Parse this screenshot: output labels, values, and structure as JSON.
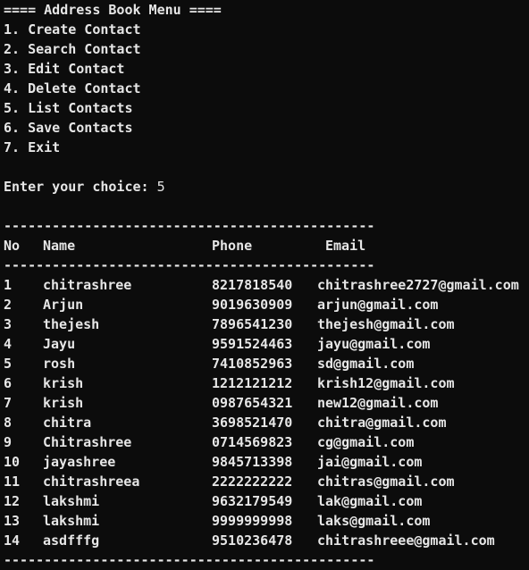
{
  "colors": {
    "background": "#0c0c0c",
    "text": "#e6e6e6"
  },
  "menu": {
    "title": "==== Address Book Menu ====",
    "options": [
      "1. Create Contact",
      "2. Search Contact",
      "3. Edit Contact",
      "4. Delete Contact",
      "5. List Contacts",
      "6. Save Contacts",
      "7. Exit"
    ]
  },
  "prompt": {
    "label": "Enter your choice: ",
    "value": "5"
  },
  "table": {
    "separator": "----------------------------------------------",
    "headers": {
      "no": "No",
      "name": "Name",
      "phone": "Phone",
      "email": "Email"
    },
    "rows": [
      {
        "no": "1",
        "name": "chitrashree",
        "phone": "8217818540",
        "email": "chitrashree2727@gmail.com"
      },
      {
        "no": "2",
        "name": "Arjun",
        "phone": "9019630909",
        "email": "arjun@gmail.com"
      },
      {
        "no": "3",
        "name": "thejesh",
        "phone": "7896541230",
        "email": "thejesh@gmail.com"
      },
      {
        "no": "4",
        "name": "Jayu",
        "phone": "9591524463",
        "email": "jayu@gmail.com"
      },
      {
        "no": "5",
        "name": "rosh",
        "phone": "7410852963",
        "email": "sd@gmail.com"
      },
      {
        "no": "6",
        "name": "krish",
        "phone": "1212121212",
        "email": "krish12@gmail.com"
      },
      {
        "no": "7",
        "name": "krish",
        "phone": "0987654321",
        "email": "new12@gmail.com"
      },
      {
        "no": "8",
        "name": "chitra",
        "phone": "3698521470",
        "email": "chitra@gmail.com"
      },
      {
        "no": "9",
        "name": "Chitrashree",
        "phone": "0714569823",
        "email": "cg@gmail.com"
      },
      {
        "no": "10",
        "name": "jayashree",
        "phone": "9845713398",
        "email": "jai@gmail.com"
      },
      {
        "no": "11",
        "name": "chitrashreea",
        "phone": "2222222222",
        "email": "chitras@gmail.com"
      },
      {
        "no": "12",
        "name": "lakshmi",
        "phone": "9632179549",
        "email": "lak@gmail.com"
      },
      {
        "no": "13",
        "name": "lakshmi",
        "phone": "9999999998",
        "email": "laks@gmail.com"
      },
      {
        "no": "14",
        "name": "asdfffg",
        "phone": "9510236478",
        "email": "chitrashreee@gmail.com"
      }
    ]
  }
}
